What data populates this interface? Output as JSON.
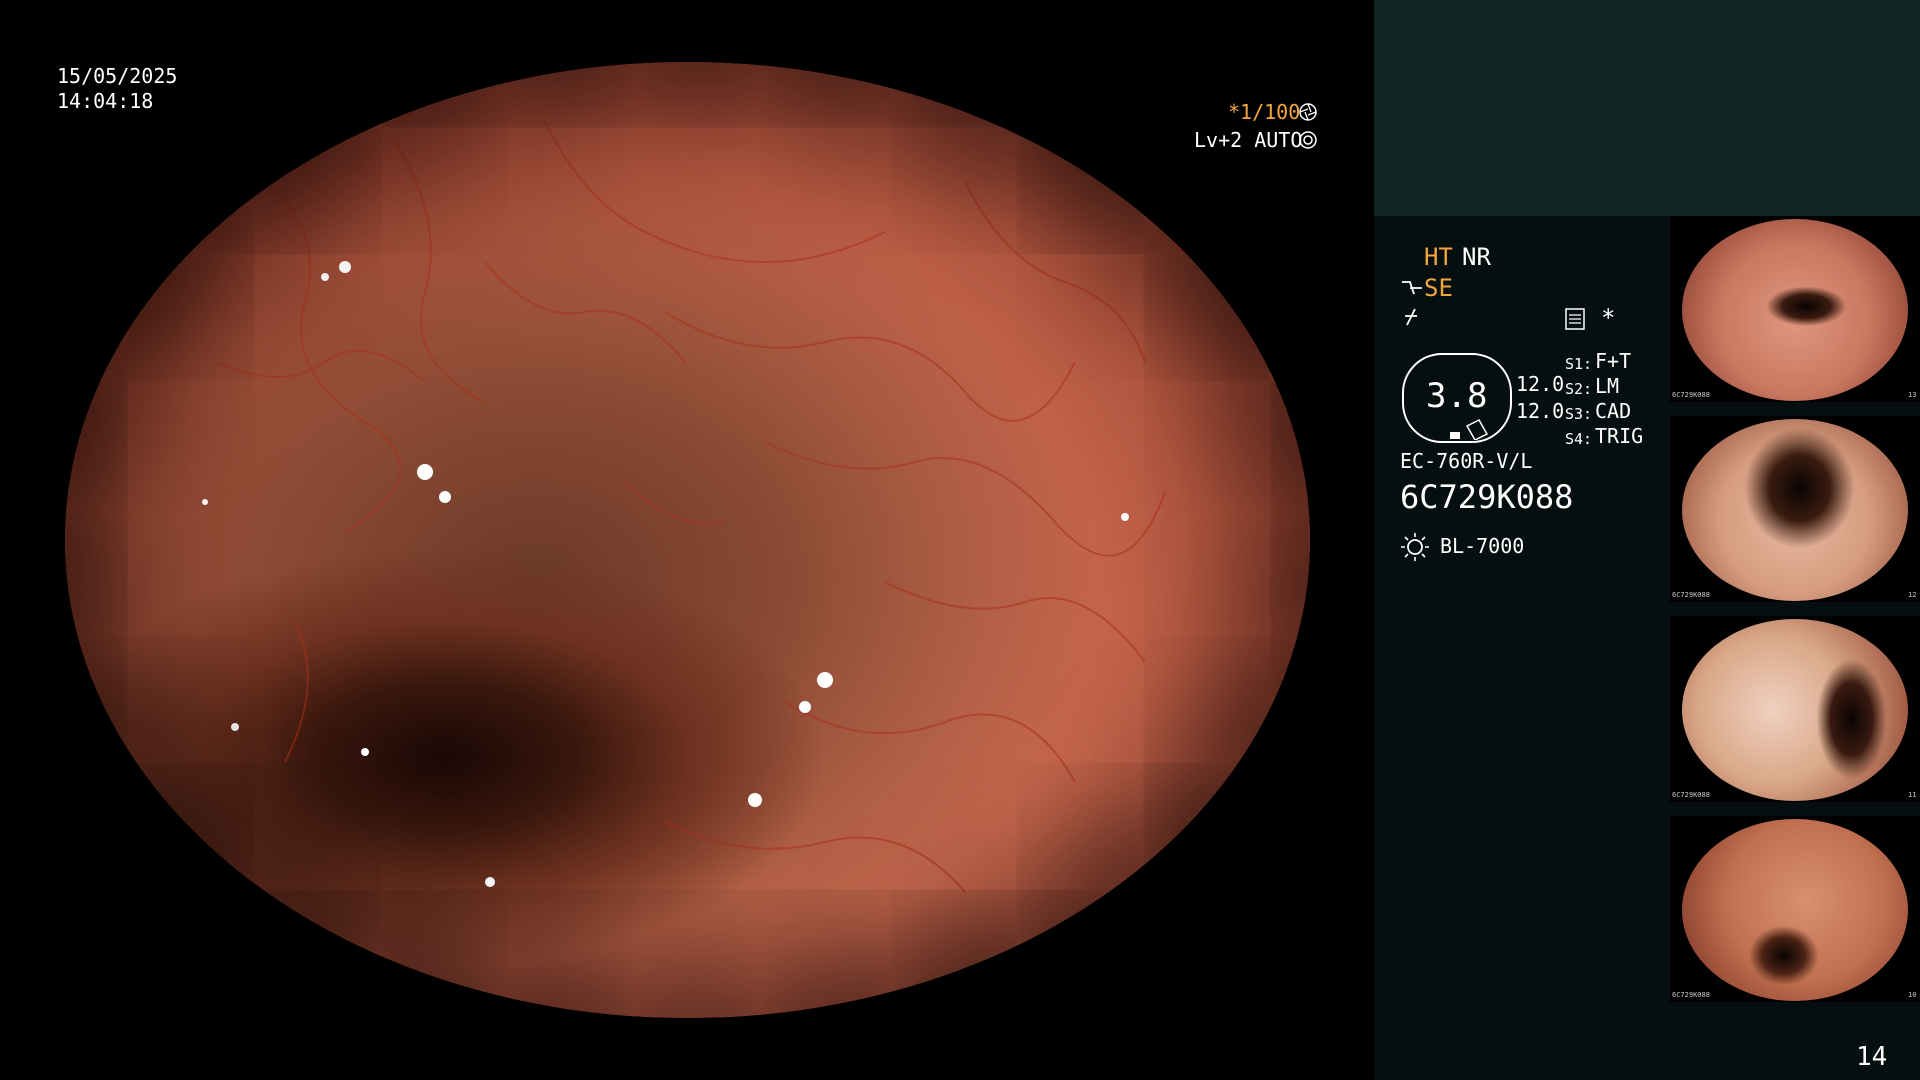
{
  "osd": {
    "date": "15/05/2025",
    "time": "14:04:18",
    "shutter": "*1/100",
    "level": "Lv+2 AUTO"
  },
  "panel": {
    "ht": "HT",
    "nr": "NR",
    "se": "SE",
    "star": "*",
    "value_main": "3.8",
    "value_a": "12.0",
    "value_b": "12.0",
    "s1": "F+T",
    "s2": "LM",
    "s3": "CAD",
    "s4": "TRIG",
    "s1_label": "S1:",
    "s2_label": "S2:",
    "s3_label": "S3:",
    "s4_label": "S4:",
    "scope_model": "EC-760R-V/L",
    "scope_serial": "6C729K088",
    "light_source": "BL-7000",
    "page_number": "14"
  },
  "thumbnails": [
    {
      "id": "13",
      "serial": "6C729K088"
    },
    {
      "id": "12",
      "serial": "6C729K088"
    },
    {
      "id": "11",
      "serial": "6C729K088"
    },
    {
      "id": "10",
      "serial": "6C729K088"
    }
  ],
  "colors": {
    "accent_orange": "#f3a640",
    "panel_header": "#0e2524",
    "panel_body": "#060f0f"
  },
  "icons": [
    "aperture-icon",
    "iris-icon",
    "curve-icon",
    "scope-icon",
    "settings-icon",
    "lamp-icon"
  ]
}
